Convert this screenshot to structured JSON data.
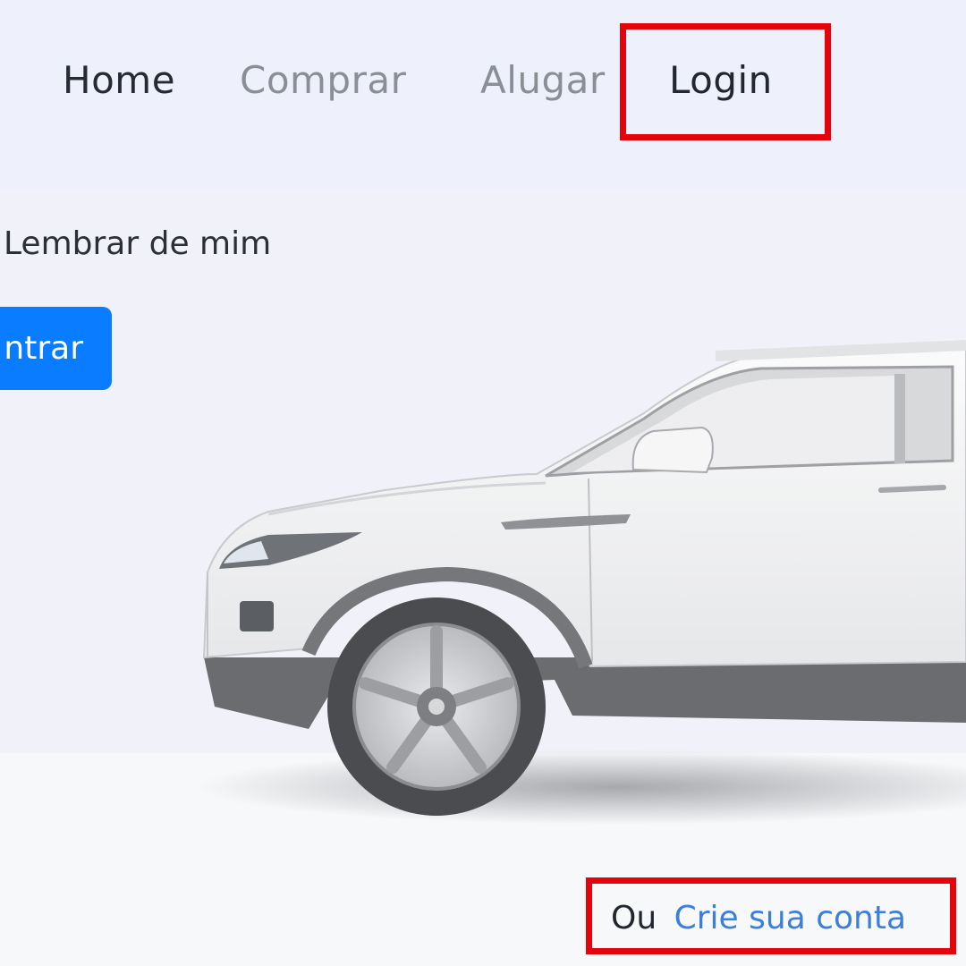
{
  "nav": {
    "home": "Home",
    "comprar": "Comprar",
    "alugar": "Alugar",
    "login": "Login"
  },
  "form": {
    "remember_label": "Lembrar de mim",
    "submit_label": "ntrar"
  },
  "footer": {
    "or_text": "Ou",
    "signup_link": "Crie sua conta"
  },
  "colors": {
    "accent": "#0a7cff",
    "link": "#3c7ed8",
    "highlight": "#e4040b"
  }
}
